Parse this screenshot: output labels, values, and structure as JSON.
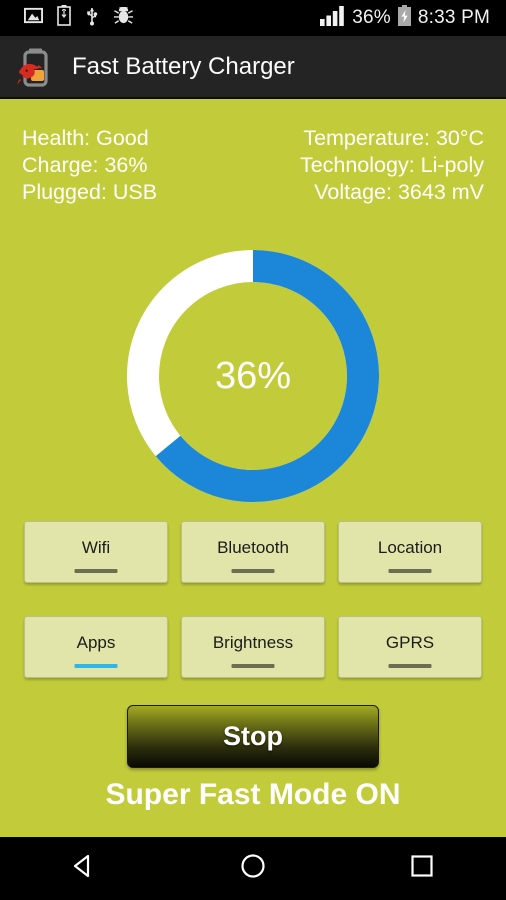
{
  "status_bar": {
    "icons_left": [
      "image-icon",
      "usb-battery-icon",
      "usb-icon",
      "bug-icon"
    ],
    "signal_icon": "signal-bars-icon",
    "battery_percent": "36%",
    "battery_icon": "charging-battery-icon",
    "time": "8:33 PM"
  },
  "app_bar": {
    "icon": "bull-battery-icon",
    "title": "Fast Battery Charger"
  },
  "info": {
    "left": [
      "Health: Good",
      "Charge: 36%",
      "Plugged: USB"
    ],
    "right": [
      "Temperature: 30°C",
      "Technology: Li-poly",
      "Voltage: 3643 mV"
    ]
  },
  "ring": {
    "percent_label": "36%",
    "percent_value": 36,
    "fill_color": "#1c86d8",
    "track_color": "#ffffff"
  },
  "toggles": {
    "row1": [
      {
        "label": "Wifi",
        "underline_color": "#6d6d52"
      },
      {
        "label": "Bluetooth",
        "underline_color": "#6d6d52"
      },
      {
        "label": "Location",
        "underline_color": "#6d6d52"
      }
    ],
    "row2": [
      {
        "label": "Apps",
        "underline_color": "#33b5e5"
      },
      {
        "label": "Brightness",
        "underline_color": "#6d6d52"
      },
      {
        "label": "GPRS",
        "underline_color": "#6d6d52"
      }
    ]
  },
  "action": {
    "stop_label": "Stop"
  },
  "mode_status": "Super Fast Mode ON",
  "nav_bar": {
    "back": "back-triangle-icon",
    "home": "home-circle-icon",
    "recents": "recents-square-icon"
  },
  "colors": {
    "background": "#c2cc3a",
    "app_bar": "#242424",
    "accent_blue": "#1c86d8",
    "toggle_bg": "#e2e5a9",
    "active_underline": "#33b5e5"
  }
}
